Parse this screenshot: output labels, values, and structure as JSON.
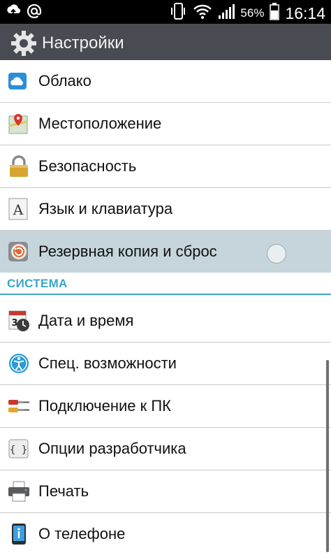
{
  "status_bar": {
    "battery_percent": "56%",
    "time": "16:14",
    "left_icons": [
      "upload-icon",
      "at-sign-icon"
    ],
    "right_icons": [
      "phone-vibrate-icon",
      "wifi-icon",
      "signal-icon",
      "battery-icon"
    ]
  },
  "action_bar": {
    "title": "Настройки",
    "icon": "gear-icon"
  },
  "items_top": [
    {
      "label": "Облако",
      "icon": "cloud-icon"
    },
    {
      "label": "Местоположение",
      "icon": "map-pin-icon"
    },
    {
      "label": "Безопасность",
      "icon": "lock-icon"
    },
    {
      "label": "Язык и клавиатура",
      "icon": "keyboard-letter-icon"
    },
    {
      "label": "Резервная копия и сброс",
      "icon": "backup-icon",
      "selected": true
    }
  ],
  "section": {
    "label": "СИСТЕМА"
  },
  "items_system": [
    {
      "label": "Дата и время",
      "icon": "calendar-clock-icon"
    },
    {
      "label": "Спец. возможности",
      "icon": "accessibility-icon"
    },
    {
      "label": "Подключение к ПК",
      "icon": "cable-icon"
    },
    {
      "label": "Опции разработчика",
      "icon": "code-braces-icon"
    },
    {
      "label": "Печать",
      "icon": "printer-icon"
    },
    {
      "label": "О телефоне",
      "icon": "phone-info-icon"
    }
  ],
  "colors": {
    "accent": "#3aa6c9",
    "action_bar": "#484c52",
    "selected_row": "#c6d5db"
  }
}
